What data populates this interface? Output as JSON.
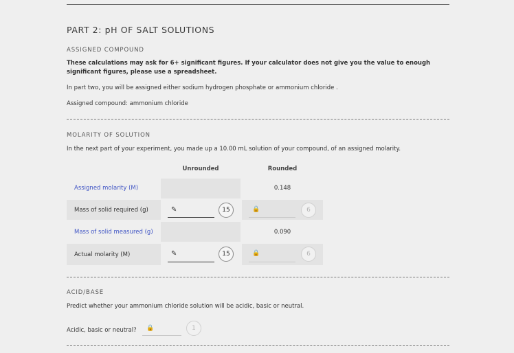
{
  "part_title": "PART 2: pH OF SALT SOLUTIONS",
  "assigned": {
    "heading": "ASSIGNED COMPOUND",
    "note": "These calculations may ask for 6+ significant figures. If your calculator does not give you the value to enough significant figures, please use a spreadsheet.",
    "intro": "In part two, you will be assigned either sodium hydrogen phosphate or ammonium chloride .",
    "compound": "Assigned compound: ammonium chloride"
  },
  "molarity": {
    "heading": "MOLARITY OF SOLUTION",
    "intro": "In the next part of your experiment, you made up a 10.00 mL solution of your compound, of an assigned molarity.",
    "col_unrounded": "Unrounded",
    "col_rounded": "Rounded",
    "rows": [
      {
        "label": "Assigned molarity (M)",
        "rounded": "0.148"
      },
      {
        "label": "Mass of solid required (g)",
        "unrounded_sigfigs": "15",
        "rounded_sigfigs": "6"
      },
      {
        "label": "Mass of solid measured (g)",
        "rounded": "0.090"
      },
      {
        "label": "Actual molarity (M)",
        "unrounded_sigfigs": "15",
        "rounded_sigfigs": "6"
      }
    ]
  },
  "acidbase": {
    "heading": "ACID/BASE",
    "intro": "Predict whether your ammonium chloride solution will be acidic, basic or neutral.",
    "question": "Acidic, basic or neutral?",
    "sigfigs": "1"
  },
  "icons": {
    "pencil": "pencil-icon",
    "lock": "lock-icon"
  }
}
